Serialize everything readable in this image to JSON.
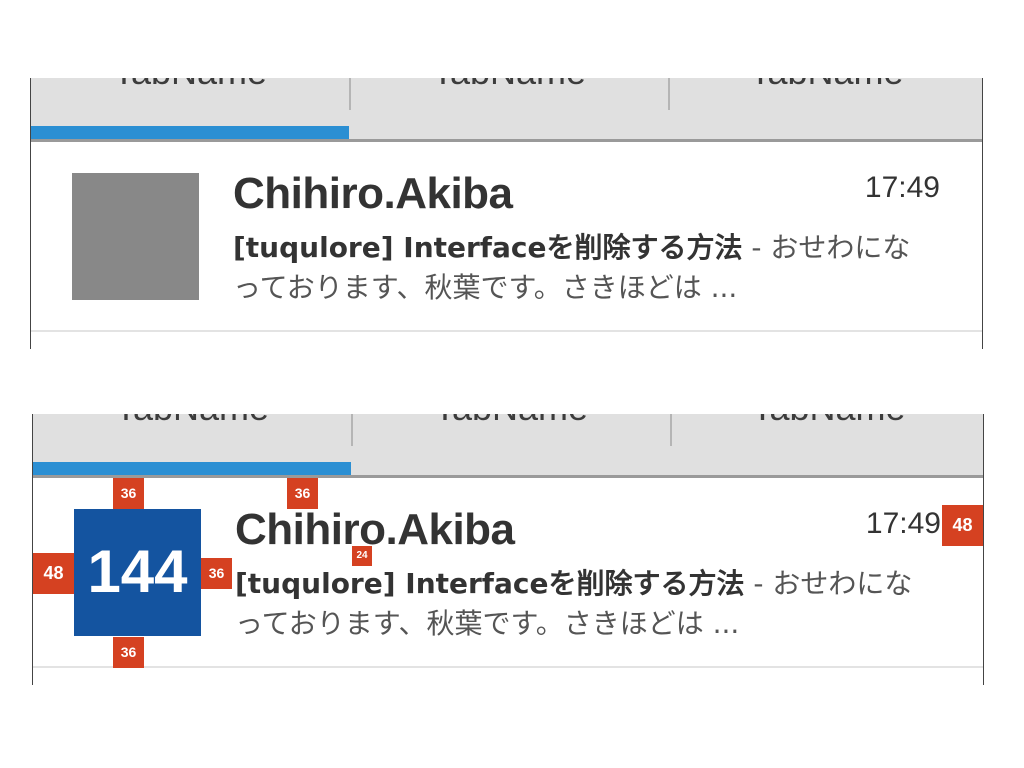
{
  "tabs": [
    {
      "label": "TabName"
    },
    {
      "label": "TabName"
    },
    {
      "label": "TabName"
    }
  ],
  "message": {
    "sender": "Chihiro.Akiba",
    "time": "17:49",
    "subject": "[tuqulore] Interfaceを削除する方法",
    "separator": " - ",
    "preview": "おせわになっております、秋葉です。さきほどは ..."
  },
  "annotations": {
    "avatar_size": "144",
    "avatar_top_margin": "36",
    "avatar_bottom_margin": "36",
    "avatar_left_margin": "48",
    "avatar_right_margin": "36",
    "sender_top_margin": "36",
    "text_gap": "24",
    "time_right_margin": "48"
  },
  "colors": {
    "tab_indicator": "#2b8fd3",
    "avatar_placeholder": "#888888",
    "avatar_annotated": "#1454a0",
    "badge": "#d54121"
  }
}
